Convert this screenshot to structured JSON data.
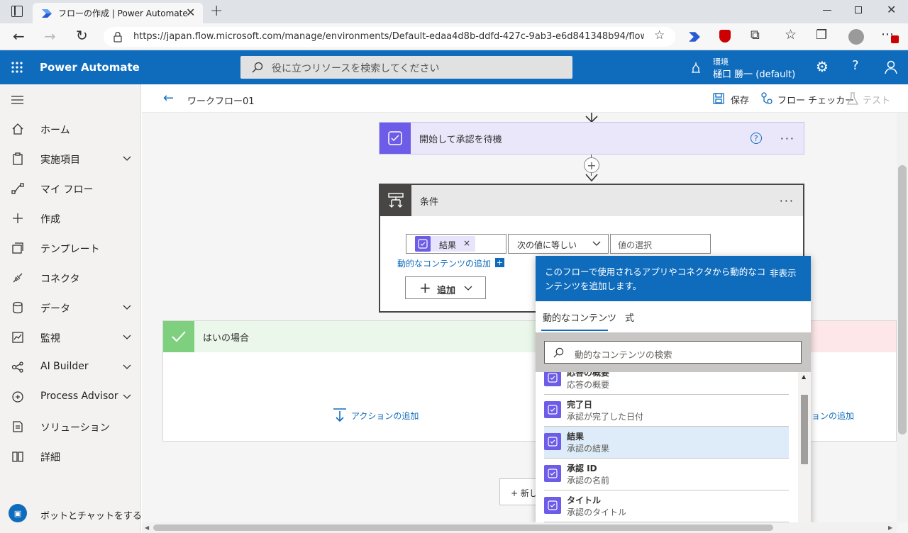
{
  "browser": {
    "tab_title": "フローの作成 | Power Automate",
    "url": "https://japan.flow.microsoft.com/manage/environments/Default-edaa4d8b-ddfd-427c-9ab3-e6d841348b94/flows/..."
  },
  "header": {
    "app_name": "Power Automate",
    "search_placeholder": "役に立つリソースを検索してください",
    "env_label": "環境",
    "env_name": "樋口 勝一 (default)"
  },
  "sidebar": {
    "items": [
      {
        "label": "ホーム",
        "icon": "home-icon"
      },
      {
        "label": "実施項目",
        "icon": "clipboard-icon",
        "expandable": true
      },
      {
        "label": "マイ フロー",
        "icon": "flow-icon"
      },
      {
        "label": "作成",
        "icon": "plus-icon"
      },
      {
        "label": "テンプレート",
        "icon": "template-icon"
      },
      {
        "label": "コネクタ",
        "icon": "connector-icon"
      },
      {
        "label": "データ",
        "icon": "database-icon",
        "expandable": true
      },
      {
        "label": "監視",
        "icon": "monitor-icon",
        "expandable": true
      },
      {
        "label": "AI Builder",
        "icon": "ai-builder-icon",
        "expandable": true
      },
      {
        "label": "Process Advisor",
        "icon": "process-advisor-icon",
        "expandable": true
      },
      {
        "label": "ソリューション",
        "icon": "solution-icon"
      },
      {
        "label": "詳細",
        "icon": "book-icon"
      }
    ],
    "chatbot_label": "ボットとチャットをする"
  },
  "commandbar": {
    "flow_name": "ワークフロー01",
    "save": "保存",
    "checker": "フロー チェッカー",
    "test": "テスト"
  },
  "canvas": {
    "approval_step": "開始して承認を待機",
    "condition_title": "条件",
    "condition_token": "結果",
    "operator": "次の値に等しい",
    "value_placeholder": "値の選択",
    "dynamic_link": "動的なコンテンツの追加",
    "add_button": "追加",
    "yes_branch": "はいの場合",
    "add_action": "アクションの追加",
    "add_action_right": "ョンの追加",
    "new_step": "+ 新し"
  },
  "dynamic_panel": {
    "description": "このフローで使用されるアプリやコネクタから動的なコンテンツを追加します。",
    "hide": "非表示",
    "tab_dynamic": "動的なコンテンツ",
    "tab_expression": "式",
    "search_placeholder": "動的なコンテンツの検索",
    "items": [
      {
        "title": "応答の概要",
        "subtitle": "応答の概要"
      },
      {
        "title": "完了日",
        "subtitle": "承認が完了した日付"
      },
      {
        "title": "結果",
        "subtitle": "承認の結果",
        "selected": true
      },
      {
        "title": "承認 ID",
        "subtitle": "承認の名前"
      },
      {
        "title": "タイトル",
        "subtitle": "承認のタイトル"
      }
    ]
  },
  "colors": {
    "brand_blue": "#0f6cbd",
    "approval_purple": "#6c5ce7",
    "yes_green": "#7ed07e",
    "selected_row": "#deecf9"
  }
}
